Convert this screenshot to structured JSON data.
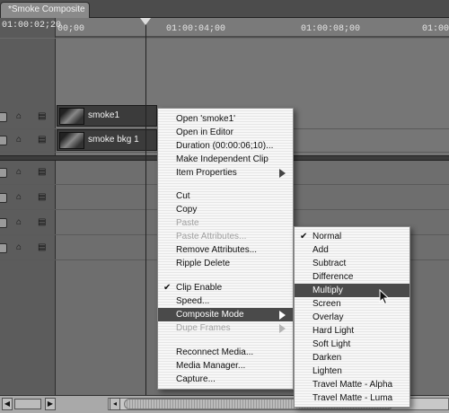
{
  "tab": {
    "title": "*Smoke Composite"
  },
  "timeline": {
    "timecode": "01:00:02;20",
    "ticks": [
      "00;00",
      "01:00:04;00",
      "01:00:08;00",
      "01:00"
    ]
  },
  "clips": [
    {
      "label": "smoke1"
    },
    {
      "label": "smoke bkg 1"
    }
  ],
  "context_menu": {
    "items": [
      {
        "label": "Open 'smoke1'"
      },
      {
        "label": "Open in Editor"
      },
      {
        "label": "Duration (00:00:06;10)..."
      },
      {
        "label": "Make Independent Clip"
      },
      {
        "label": "Item Properties"
      },
      {
        "label": "Cut"
      },
      {
        "label": "Copy"
      },
      {
        "label": "Paste"
      },
      {
        "label": "Paste Attributes..."
      },
      {
        "label": "Remove Attributes..."
      },
      {
        "label": "Ripple Delete"
      },
      {
        "label": "Clip Enable"
      },
      {
        "label": "Speed..."
      },
      {
        "label": "Composite Mode"
      },
      {
        "label": "Dupe Frames"
      },
      {
        "label": "Reconnect Media..."
      },
      {
        "label": "Media Manager..."
      },
      {
        "label": "Capture..."
      }
    ]
  },
  "composite_submenu": {
    "items": [
      {
        "label": "Normal"
      },
      {
        "label": "Add"
      },
      {
        "label": "Subtract"
      },
      {
        "label": "Difference"
      },
      {
        "label": "Multiply"
      },
      {
        "label": "Screen"
      },
      {
        "label": "Overlay"
      },
      {
        "label": "Hard Light"
      },
      {
        "label": "Soft Light"
      },
      {
        "label": "Darken"
      },
      {
        "label": "Lighten"
      },
      {
        "label": "Travel Matte - Alpha"
      },
      {
        "label": "Travel Matte - Luma"
      }
    ]
  },
  "icons": {
    "check": "✔",
    "lock": "🔒",
    "cursor": "arrow-cursor-icon"
  }
}
